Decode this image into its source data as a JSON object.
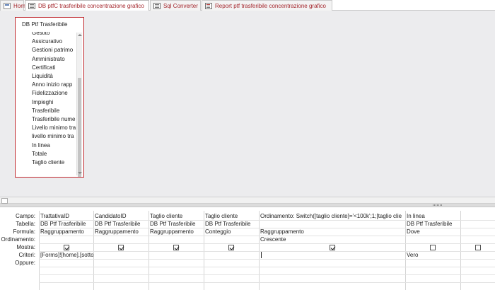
{
  "tabs": [
    {
      "label": "Home",
      "icon": "home-icon",
      "active": false
    },
    {
      "label": "DB ptfC trasferibile concentrazione grafico",
      "icon": "query-icon",
      "active": true
    },
    {
      "label": "Sql Converter",
      "icon": "query-icon",
      "active": false
    },
    {
      "label": "Report ptf trasferibile concentrazione grafico",
      "icon": "report-icon",
      "active": false
    }
  ],
  "field_table": {
    "title": "DB Ptf Trasferibile",
    "fields": [
      "Gestito",
      "Assicurativo",
      "Gestioni patrimo",
      "Amministrato",
      "Certificati",
      "Liquidità",
      "Anno inizio rapp",
      "Fidelizzazione",
      "Impieghi",
      "Trasferibile",
      "Trasferibile nume",
      "Livello minimo tra",
      "livello minimo tra",
      "In linea",
      "Totale",
      "Taglio cliente"
    ]
  },
  "grid": {
    "row_labels": {
      "campo": "Campo:",
      "tabella": "Tabella:",
      "formula": "Formula:",
      "ordinamento": "Ordinamento:",
      "mostra": "Mostra:",
      "criteri": "Criteri:",
      "oppure": "Oppure:"
    },
    "columns": [
      {
        "campo": "TrattativaID",
        "tabella": "DB Ptf Trasferibile",
        "formula": "Raggruppamento",
        "ordinamento": "",
        "mostra": true,
        "criteri": "[Forms]![home].[sottom",
        "oppure": ""
      },
      {
        "campo": "CandidatoID",
        "tabella": "DB Ptf Trasferibile",
        "formula": "Raggruppamento",
        "ordinamento": "",
        "mostra": true,
        "criteri": "",
        "oppure": ""
      },
      {
        "campo": "Taglio cliente",
        "tabella": "DB Ptf Trasferibile",
        "formula": "Raggruppamento",
        "ordinamento": "",
        "mostra": true,
        "criteri": "",
        "oppure": ""
      },
      {
        "campo": "Taglio cliente",
        "tabella": "DB Ptf Trasferibile",
        "formula": "Conteggio",
        "ordinamento": "",
        "mostra": true,
        "criteri": "",
        "oppure": ""
      },
      {
        "campo": "Ordinamento: Switch([taglio cliente]='<100k';1;[taglio clie",
        "tabella": "",
        "formula": "Raggruppamento",
        "ordinamento": "Crescente",
        "mostra": true,
        "criteri": "",
        "oppure": ""
      },
      {
        "campo": "In linea",
        "tabella": "DB Ptf Trasferibile",
        "formula": "Dove",
        "ordinamento": "",
        "mostra": false,
        "criteri": "Vero",
        "oppure": ""
      },
      {
        "campo": "",
        "tabella": "",
        "formula": "",
        "ordinamento": "",
        "mostra": false,
        "criteri": "",
        "oppure": ""
      }
    ]
  }
}
